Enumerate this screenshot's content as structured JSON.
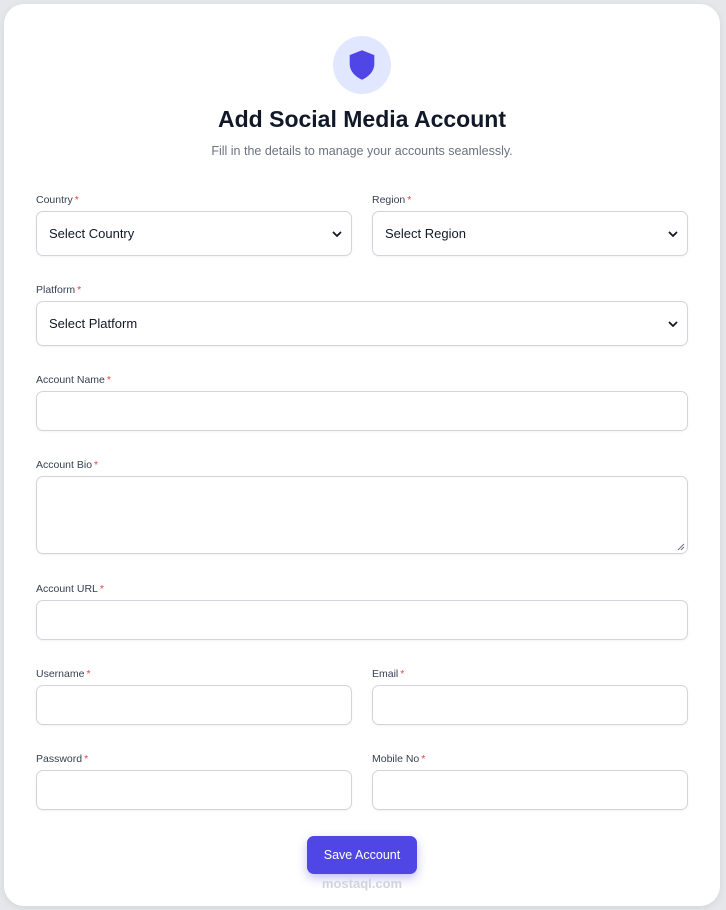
{
  "header": {
    "title": "Add Social Media Account",
    "subtitle": "Fill in the details to manage your accounts seamlessly.",
    "icon": "shield-icon"
  },
  "form": {
    "country": {
      "label": "Country",
      "required": "*",
      "value": "Select Country"
    },
    "region": {
      "label": "Region",
      "required": "*",
      "value": "Select Region"
    },
    "platform": {
      "label": "Platform",
      "required": "*",
      "value": "Select Platform"
    },
    "account_name": {
      "label": "Account Name",
      "required": "*",
      "value": ""
    },
    "account_bio": {
      "label": "Account Bio",
      "required": "*",
      "value": ""
    },
    "account_url": {
      "label": "Account URL",
      "required": "*",
      "value": ""
    },
    "username": {
      "label": "Username",
      "required": "*",
      "value": ""
    },
    "email": {
      "label": "Email",
      "required": "*",
      "value": ""
    },
    "password": {
      "label": "Password",
      "required": "*",
      "value": ""
    },
    "mobile": {
      "label": "Mobile No",
      "required": "*",
      "value": ""
    }
  },
  "actions": {
    "save_label": "Save Account"
  },
  "watermark": "mostaql.com",
  "colors": {
    "accent": "#4f46e5",
    "icon_bg": "#e0e7ff",
    "required": "#ef4444"
  }
}
